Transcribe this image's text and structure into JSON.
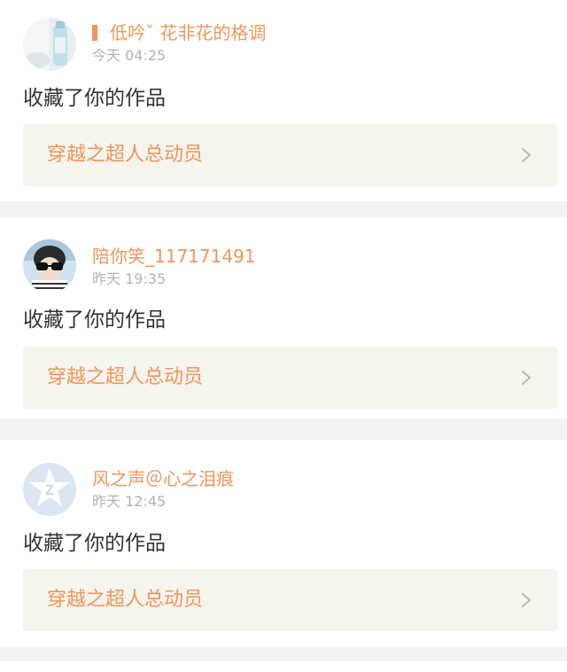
{
  "colors": {
    "accent": "#f0965a",
    "time": "#b3b3b3",
    "action_text": "#333333",
    "link_bg": "#f5f4ed",
    "separator": "#f2f2f2"
  },
  "notifications": [
    {
      "avatar_icon": "water-bottle-photo-avatar",
      "username": "低吟ˇ 花非花的格调",
      "time": "今天 04:25",
      "action": "收藏了你的作品",
      "work_title": "穿越之超人总动员",
      "chevron_icon": "chevron-right-icon"
    },
    {
      "avatar_icon": "sunglasses-person-avatar",
      "username": "陪你笑_117171491",
      "time": "昨天 19:35",
      "action": "收藏了你的作品",
      "work_title": "穿越之超人总动员",
      "chevron_icon": "chevron-right-icon"
    },
    {
      "avatar_icon": "default-star-avatar",
      "username": "风之声＠心之泪痕",
      "time": "昨天 12:45",
      "action": "收藏了你的作品",
      "work_title": "穿越之超人总动员",
      "chevron_icon": "chevron-right-icon"
    }
  ]
}
